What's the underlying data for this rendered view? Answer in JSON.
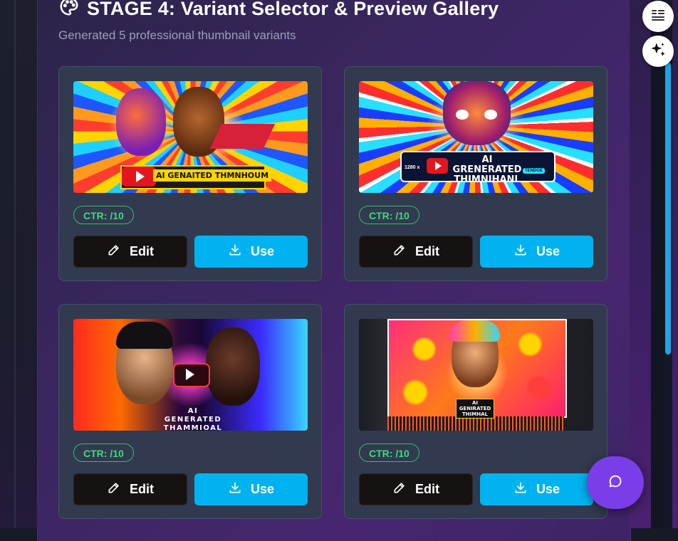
{
  "stage": {
    "title": "STAGE 4: Variant Selector & Preview Gallery",
    "subtitle": "Generated 5 professional thumbnail variants",
    "icon": "palette-icon"
  },
  "variants": [
    {
      "thumbnail_text": "AI GENAITED THMNHOUM",
      "ctr_label": "CTR: /10",
      "edit_label": "Edit",
      "use_label": "Use"
    },
    {
      "thumbnail_text": "AI GRENERATED THIMNIHANL",
      "thumbnail_badge": "1280 x",
      "thumbnail_tag": "TENDGE",
      "ctr_label": "CTR: /10",
      "edit_label": "Edit",
      "use_label": "Use"
    },
    {
      "thumbnail_text": "AI GENERATED THAMMIOAL",
      "ctr_label": "CTR: /10",
      "edit_label": "Edit",
      "use_label": "Use"
    },
    {
      "thumbnail_text": "AI GENIRATED THIMHAL",
      "ctr_label": "CTR: /10",
      "edit_label": "Edit",
      "use_label": "Use"
    }
  ],
  "icons": {
    "edit": "pencil-icon",
    "use": "download-icon",
    "side_top": "quote-list-icon",
    "side_bottom": "sparkles-icon",
    "fab": "chat-bubble-icon"
  },
  "colors": {
    "ctr_green": "#3ddc7f",
    "use_blue": "#00b3f0",
    "edit_dark": "#161212",
    "card_bg": "#313a4e",
    "fab_purple": "#7a3ee8"
  }
}
